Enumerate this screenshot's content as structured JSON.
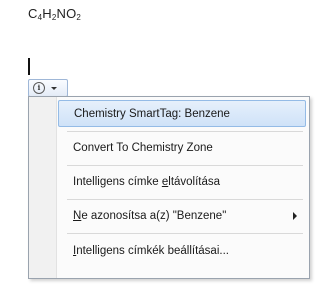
{
  "formula": {
    "parts": [
      "C",
      "4",
      "H",
      "2",
      "NO",
      "2"
    ]
  },
  "smart_tag": {
    "icon": "info-icon",
    "dropdown_icon": "chevron-down-icon"
  },
  "menu": {
    "items": [
      {
        "label": "Chemistry SmartTag: Benzene"
      },
      {
        "label": "Convert To Chemistry Zone"
      },
      {
        "pre": "Intelligens címke ",
        "accel": "e",
        "post": "ltávolítása"
      },
      {
        "pre": "",
        "accel": "N",
        "post": "e azonosítsa a(z) \"Benzene\""
      },
      {
        "pre": "",
        "accel": "I",
        "post": "ntelligens címkék beállításai..."
      }
    ]
  }
}
